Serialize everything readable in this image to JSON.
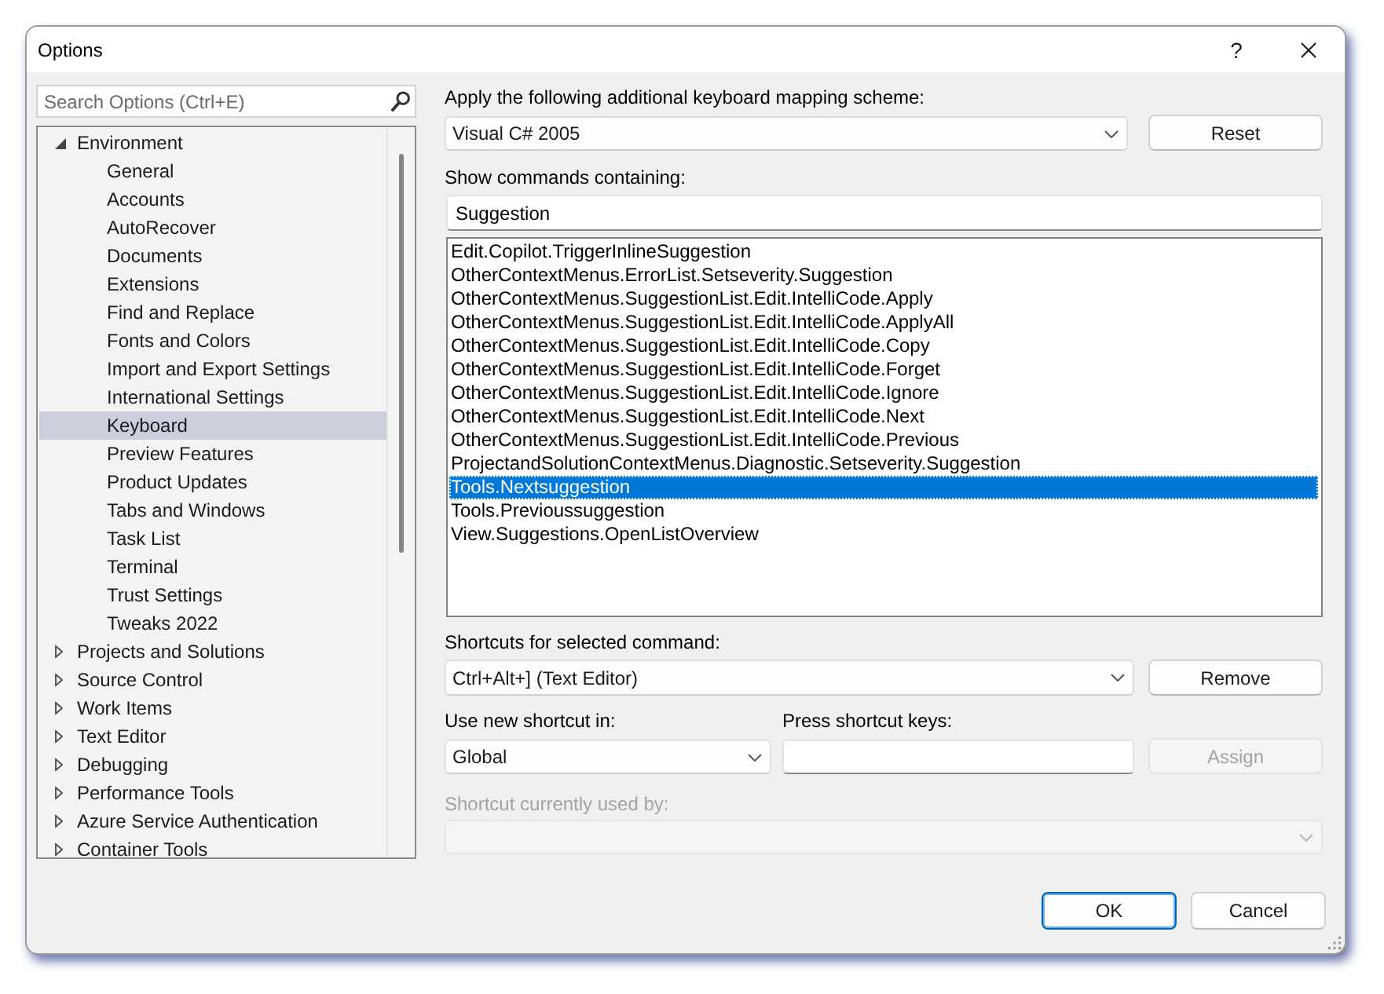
{
  "window": {
    "title": "Options",
    "help": "?"
  },
  "sidebar": {
    "search": {
      "placeholder": "Search Options (Ctrl+E)"
    },
    "tree": [
      {
        "label": "Environment",
        "expanded": true,
        "selected": false,
        "children": [
          {
            "label": "General",
            "selected": false
          },
          {
            "label": "Accounts",
            "selected": false
          },
          {
            "label": "AutoRecover",
            "selected": false
          },
          {
            "label": "Documents",
            "selected": false
          },
          {
            "label": "Extensions",
            "selected": false
          },
          {
            "label": "Find and Replace",
            "selected": false
          },
          {
            "label": "Fonts and Colors",
            "selected": false
          },
          {
            "label": "Import and Export Settings",
            "selected": false
          },
          {
            "label": "International Settings",
            "selected": false
          },
          {
            "label": "Keyboard",
            "selected": true
          },
          {
            "label": "Preview Features",
            "selected": false
          },
          {
            "label": "Product Updates",
            "selected": false
          },
          {
            "label": "Tabs and Windows",
            "selected": false
          },
          {
            "label": "Task List",
            "selected": false
          },
          {
            "label": "Terminal",
            "selected": false
          },
          {
            "label": "Trust Settings",
            "selected": false
          },
          {
            "label": "Tweaks 2022",
            "selected": false
          }
        ]
      },
      {
        "label": "Projects and Solutions",
        "expanded": false,
        "selected": false
      },
      {
        "label": "Source Control",
        "expanded": false,
        "selected": false
      },
      {
        "label": "Work Items",
        "expanded": false,
        "selected": false
      },
      {
        "label": "Text Editor",
        "expanded": false,
        "selected": false
      },
      {
        "label": "Debugging",
        "expanded": false,
        "selected": false
      },
      {
        "label": "Performance Tools",
        "expanded": false,
        "selected": false
      },
      {
        "label": "Azure Service Authentication",
        "expanded": false,
        "selected": false
      },
      {
        "label": "Container Tools",
        "expanded": false,
        "selected": false
      }
    ]
  },
  "keyboard": {
    "mapping_scheme": {
      "label": "Apply the following additional keyboard mapping scheme:",
      "value": "Visual C# 2005"
    },
    "reset_button": {
      "label": "Reset",
      "disabled": false
    },
    "filter": {
      "label": "Show commands containing:",
      "value": "Suggestion"
    },
    "commands": [
      {
        "label": "Edit.Copilot.TriggerInlineSuggestion",
        "selected": false
      },
      {
        "label": "OtherContextMenus.ErrorList.Setseverity.Suggestion",
        "selected": false
      },
      {
        "label": "OtherContextMenus.SuggestionList.Edit.IntelliCode.Apply",
        "selected": false
      },
      {
        "label": "OtherContextMenus.SuggestionList.Edit.IntelliCode.ApplyAll",
        "selected": false
      },
      {
        "label": "OtherContextMenus.SuggestionList.Edit.IntelliCode.Copy",
        "selected": false
      },
      {
        "label": "OtherContextMenus.SuggestionList.Edit.IntelliCode.Forget",
        "selected": false
      },
      {
        "label": "OtherContextMenus.SuggestionList.Edit.IntelliCode.Ignore",
        "selected": false
      },
      {
        "label": "OtherContextMenus.SuggestionList.Edit.IntelliCode.Next",
        "selected": false
      },
      {
        "label": "OtherContextMenus.SuggestionList.Edit.IntelliCode.Previous",
        "selected": false
      },
      {
        "label": "ProjectandSolutionContextMenus.Diagnostic.Setseverity.Suggestion",
        "selected": false
      },
      {
        "label": "Tools.Nextsuggestion",
        "selected": true
      },
      {
        "label": "Tools.Previoussuggestion",
        "selected": false
      },
      {
        "label": "View.Suggestions.OpenListOverview",
        "selected": false
      }
    ],
    "shortcuts": {
      "label": "Shortcuts for selected command:",
      "value": "Ctrl+Alt+] (Text Editor)"
    },
    "remove_button": {
      "label": "Remove",
      "disabled": false
    },
    "use_in": {
      "label": "Use new shortcut in:",
      "value": "Global"
    },
    "press_keys": {
      "label": "Press shortcut keys:"
    },
    "assign_button": {
      "label": "Assign",
      "disabled": true
    },
    "used_by": {
      "label": "Shortcut currently used by:",
      "disabled": true
    }
  },
  "buttons": [
    {
      "label": "OK",
      "default": true
    },
    {
      "label": "Cancel",
      "default": false
    }
  ]
}
